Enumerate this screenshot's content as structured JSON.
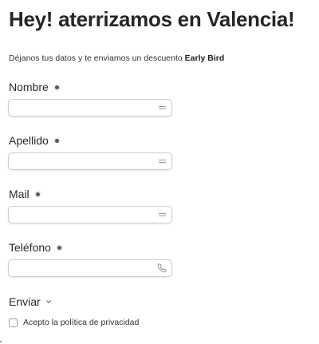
{
  "page": {
    "title": "Hey! aterrizamos en Valencia!",
    "subtitle_prefix": "Déjanos tus datos y te enviamos un descuento ",
    "subtitle_bold": "Early Bird"
  },
  "form": {
    "fields": [
      {
        "label": "Nombre",
        "required": true,
        "value": "",
        "icon": "contact-card-icon"
      },
      {
        "label": "Apellido",
        "required": true,
        "value": "",
        "icon": "contact-card-icon"
      },
      {
        "label": "Mail",
        "required": true,
        "value": "",
        "icon": "contact-card-icon"
      },
      {
        "label": "Teléfono",
        "required": true,
        "value": "",
        "icon": "phone-icon"
      }
    ],
    "submit_label": "Enviar",
    "submit_icon": "chevron-down-icon",
    "consent_label": "Acepto la política de privacidad",
    "consent_checked": false
  },
  "colors": {
    "text": "#262626",
    "input_border": "#cfcfcf",
    "icon": "#9a9a9a",
    "background": "#ffffff"
  }
}
